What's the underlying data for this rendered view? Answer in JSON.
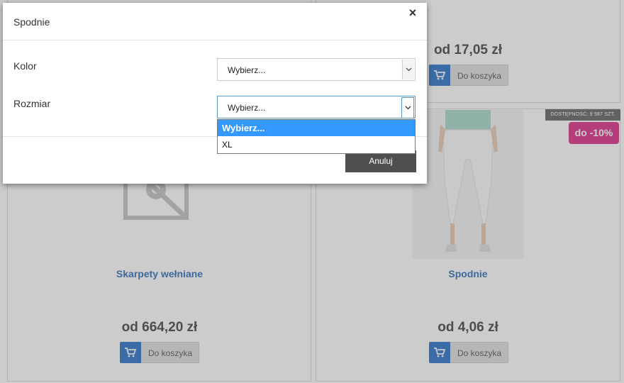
{
  "products": {
    "top_right_price": "od 17,05 zł",
    "add_to_cart_label": "Do koszyka",
    "bottom_left": {
      "name": "Skarpety wełniane",
      "price": "od 664,20 zł"
    },
    "bottom_right": {
      "name": "Spodnie",
      "price": "od 4,06 zł",
      "stock_badge": "DOSTĘPNOŚĆ: 9 587 SZT.",
      "discount_badge": "do -10%"
    }
  },
  "modal": {
    "title": "Spodnie",
    "close_icon": "×",
    "fields": {
      "color_label": "Kolor",
      "color_value": "Wybierz...",
      "size_label": "Rozmiar",
      "size_value": "Wybierz..."
    },
    "size_options": [
      "Wybierz...",
      "XL"
    ],
    "size_selected_index": 0,
    "cancel_label": "Anuluj"
  },
  "colors": {
    "accent_blue": "#1565c0",
    "link_blue": "#1a5fb4",
    "discount_pink": "#d81b7b",
    "dropdown_highlight": "#3399ff"
  }
}
